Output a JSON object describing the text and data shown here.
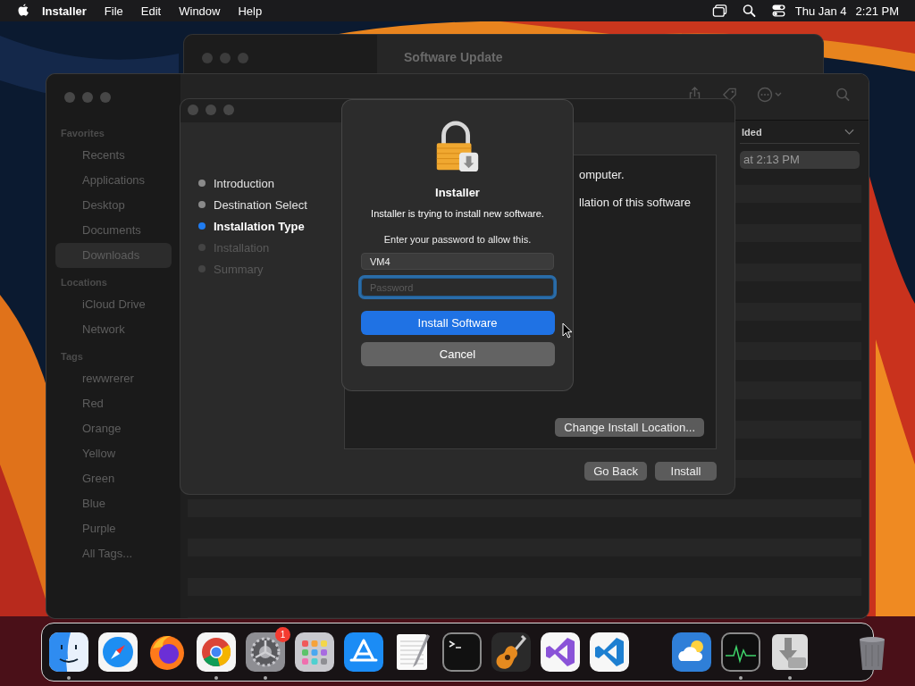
{
  "menubar": {
    "app": "Installer",
    "menus": [
      "File",
      "Edit",
      "Window",
      "Help"
    ],
    "date": "Thu Jan 4",
    "time": "2:21 PM"
  },
  "software_update_window": {
    "title": "Software Update"
  },
  "finder": {
    "sidebar": [
      {
        "heading": "Favorites",
        "items": [
          {
            "label": "Recents",
            "selected": false
          },
          {
            "label": "Applications",
            "selected": false
          },
          {
            "label": "Desktop",
            "selected": false
          },
          {
            "label": "Documents",
            "selected": false
          },
          {
            "label": "Downloads",
            "selected": true
          }
        ]
      },
      {
        "heading": "Locations",
        "items": [
          {
            "label": "iCloud Drive",
            "selected": false
          },
          {
            "label": "Network",
            "selected": false
          }
        ]
      },
      {
        "heading": "Tags",
        "items": [
          {
            "label": "rewwrerer",
            "selected": false
          },
          {
            "label": "Red",
            "selected": false
          },
          {
            "label": "Orange",
            "selected": false
          },
          {
            "label": "Yellow",
            "selected": false
          },
          {
            "label": "Green",
            "selected": false
          },
          {
            "label": "Blue",
            "selected": false
          },
          {
            "label": "Purple",
            "selected": false
          },
          {
            "label": "All Tags...",
            "selected": false
          }
        ]
      }
    ],
    "column_header": "lded",
    "rows": [
      {
        "text": "at 2:13 PM",
        "selected": true
      }
    ]
  },
  "installer": {
    "steps": [
      {
        "label": "Introduction",
        "selected": false,
        "disabled": false
      },
      {
        "label": "Destination Select",
        "selected": false,
        "disabled": false
      },
      {
        "label": "Installation Type",
        "selected": true,
        "disabled": false
      },
      {
        "label": "Installation",
        "selected": false,
        "disabled": true
      },
      {
        "label": "Summary",
        "selected": false,
        "disabled": true
      }
    ],
    "body_lines": [
      "omputer.",
      "llation of this software"
    ],
    "change_location_button": "Change Install Location...",
    "buttons": [
      "Go Back",
      "Install"
    ]
  },
  "dialog": {
    "title": "Installer",
    "message": "Installer is trying to install new software.",
    "prompt": "Enter your password to allow this.",
    "username": "VM4",
    "password_placeholder": "Password",
    "password_focused": true,
    "buttons": [
      {
        "label": "Install Software",
        "kind": "primary"
      },
      {
        "label": "Cancel",
        "kind": "secondary"
      }
    ]
  },
  "dock": {
    "groups": [
      [
        {
          "running": true
        },
        {
          "running": false
        },
        {
          "running": false
        },
        {
          "running": true
        },
        {
          "running": true,
          "badge": "1"
        },
        {
          "running": false
        },
        {
          "running": false
        },
        {
          "running": false
        },
        {
          "running": false
        },
        {
          "running": false
        },
        {
          "running": false
        },
        {
          "running": false
        }
      ],
      [
        {
          "running": false
        },
        {
          "running": true
        },
        {
          "running": true
        }
      ],
      [
        {
          "running": false
        }
      ]
    ]
  }
}
